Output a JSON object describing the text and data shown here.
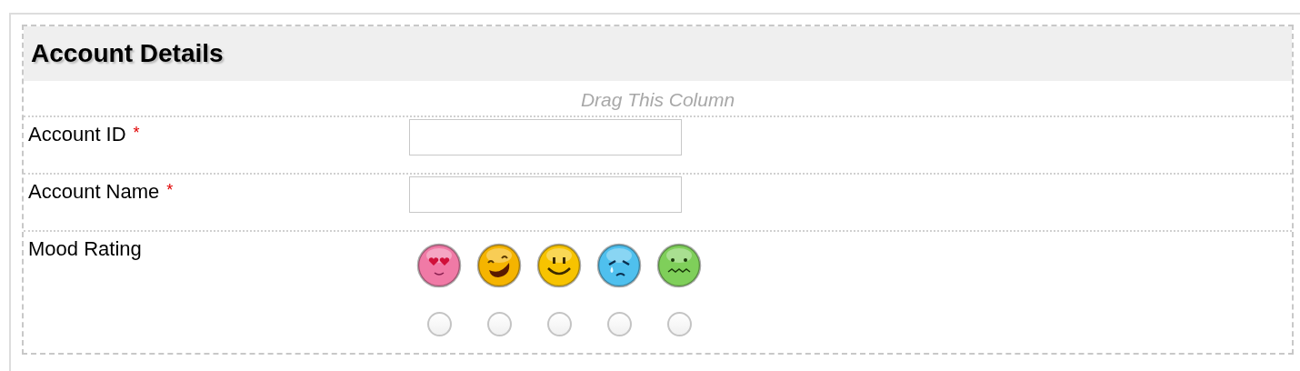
{
  "section": {
    "title": "Account Details",
    "drag_hint": "Drag This Column"
  },
  "fields": [
    {
      "kind": "text",
      "label": "Account ID",
      "required_mark": "*"
    },
    {
      "kind": "text",
      "label": "Account Name",
      "required_mark": "*"
    },
    {
      "kind": "rating",
      "label": "Mood Rating",
      "options": [
        {
          "kind": "love",
          "color": "#f07aa6",
          "selected": false
        },
        {
          "kind": "laughing",
          "color": "#f5b400",
          "selected": false
        },
        {
          "kind": "smile",
          "color": "#f7c300",
          "selected": false
        },
        {
          "kind": "crying",
          "color": "#4fc0ee",
          "selected": false
        },
        {
          "kind": "sick",
          "color": "#7fcf5a",
          "selected": false
        }
      ]
    }
  ]
}
